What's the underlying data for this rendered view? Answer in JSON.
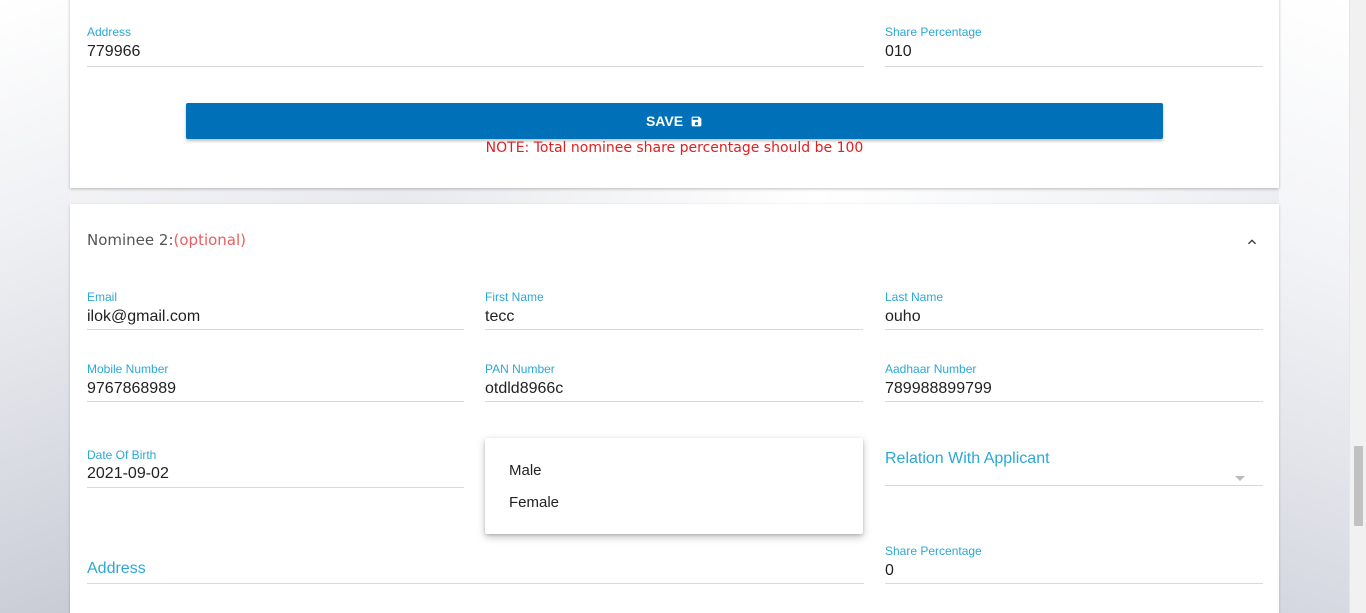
{
  "nominee1": {
    "address": {
      "label": "Address",
      "value": "779966"
    },
    "share_percentage": {
      "label": "Share Percentage",
      "value": "010"
    },
    "save_label": "SAVE",
    "save_icon": "floppy-disk-icon",
    "note": "NOTE: Total nominee share percentage should be 100"
  },
  "nominee2": {
    "title": "Nominee 2:",
    "optional": "(optional)",
    "collapse_icon": "chevron-up-icon",
    "email": {
      "label": "Email",
      "value": "ilok@gmail.com"
    },
    "first_name": {
      "label": "First Name",
      "value": "tecc"
    },
    "last_name": {
      "label": "Last Name",
      "value": "ouho"
    },
    "mobile": {
      "label": "Mobile Number",
      "value": "9767868989"
    },
    "pan": {
      "label": "PAN Number",
      "value": "otdld8966c"
    },
    "aadhaar": {
      "label": "Aadhaar Number",
      "value": "789988899799"
    },
    "dob": {
      "label": "Date Of Birth",
      "value": "2021-09-02"
    },
    "gender_options": [
      "Male",
      "Female"
    ],
    "relation": {
      "placeholder": "Relation With Applicant"
    },
    "address": {
      "placeholder": "Address"
    },
    "share_percentage": {
      "label": "Share Percentage",
      "value": "0"
    }
  },
  "colors": {
    "label": "#2ba8d6",
    "button": "#0070b8",
    "note": "#e01f1f",
    "optional": "#e86060"
  }
}
